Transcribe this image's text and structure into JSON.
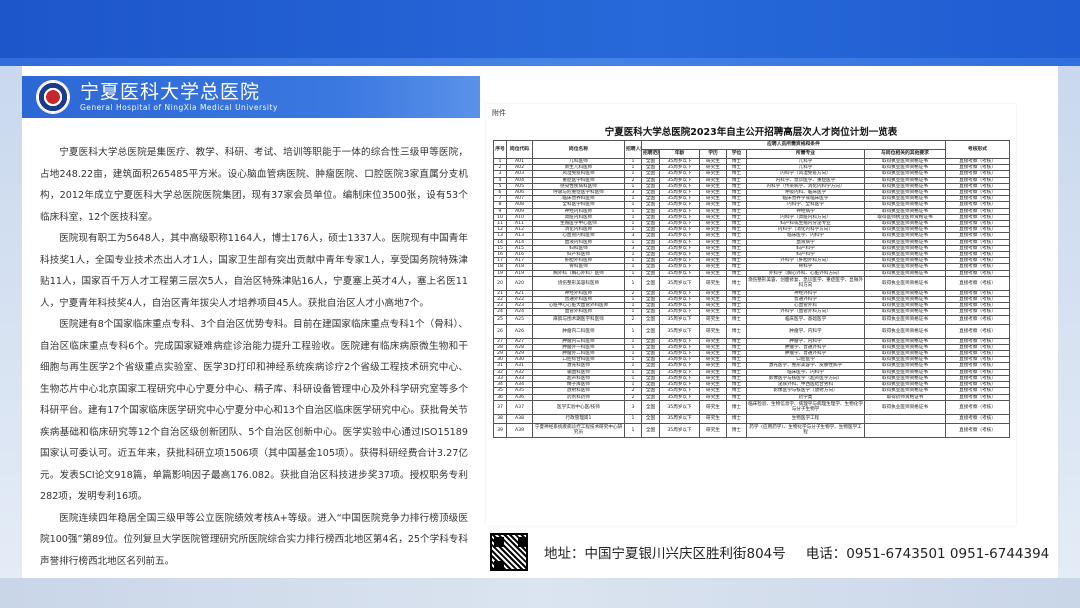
{
  "header": {
    "hospital_name_cn": "宁夏医科大学总医院",
    "hospital_name_en": "General Hospital of NingXia Medical University"
  },
  "intro": {
    "paragraphs": [
      "宁夏医科大学总医院是集医疗、教学、科研、考试、培训等职能于一体的综合性三级甲等医院，占地248.22亩，建筑面积265485平方米。设心脑血管病医院、肿瘤医院、口腔医院3家直属分支机构，2012年成立宁夏医科大学总医院医院集团，现有37家会员单位。编制床位3500张，设有53个临床科室，12个医技科室。",
      "医院现有职工为5648人，其中高级职称1164人，博士176人，硕士1337人。医院现有中国青年科技奖1人，全国专业技术杰出人才1人，国家卫生部有突出贡献中青年专家1人，享受国务院特殊津贴11人，国家百千万人才工程第三层次5人，自治区特殊津贴16人，宁夏塞上英才4人，塞上名医11人，宁夏青年科技奖4人，自治区青年拔尖人才培养项目45人。获批自治区人才小高地7个。",
      "医院建有8个国家临床重点专科、3个自治区优势专科。目前在建国家临床重点专科1个（骨科）、自治区临床重点专科6个。完成国家疑难病症诊治能力提升工程验收。医院建有临床病原微生物和干细胞与再生医学2个省级重点实验室、医学3D打印和神经系统疾病诊疗2个省级工程技术研究中心、生物芯片中心北京国家工程研究中心宁夏分中心、精子库、科研设备管理中心及外科学研究室等多个科研平台。建有17个国家临床医学研究中心宁夏分中心和13个自治区临床医学研究中心。获批骨关节疾病基础和临床研究等12个自治区级创新团队、5个自治区创新中心。医学实验中心通过ISO15189国家认可委认可。近五年来，获批科研立项1506项（其中国基金105项）。获得科研经费合计3.27亿元。发表SCI论文918篇，单篇影响因子最高176.082。获批自治区科技进步奖37项。授权职务专利282项，发明专利16项。",
      "医院连续四年稳居全国三级甲等公立医院绩效考核A+等级。进入“中国医院竞争力排行榜顶级医院100强”第89位。位列复旦大学医院管理研究所医院综合实力排行榜西北地区第4名，25个学科专科声誉排行榜西北地区名列前五。"
    ]
  },
  "document": {
    "attachment_label": "附件",
    "title": "宁夏医科大学总医院2023年自主公开招聘高层次人才岗位计划一览表",
    "headers": {
      "seq": "序号",
      "code": "岗位代码",
      "post": "岗位名称",
      "count": "招聘人数",
      "group": "应聘人员所需资格和条件",
      "scope": "招聘范围",
      "age": "年龄",
      "edu": "学历",
      "degree": "学位",
      "major": "所需专业",
      "other": "与岗位相关的其他要求",
      "exam": "考核形式"
    },
    "rows": [
      [
        "1",
        "A01",
        "儿科医师",
        "1",
        "全国",
        "35周岁以下",
        "研究生",
        "博士",
        "儿科学",
        "取得执业医师资格证书",
        "直接考察（考核）"
      ],
      [
        "2",
        "A02",
        "新生儿科医师",
        "1",
        "全国",
        "35周岁以下",
        "研究生",
        "博士",
        "儿科学",
        "取得执业医师资格证书",
        "直接考察（考核）"
      ],
      [
        "3",
        "A03",
        "风湿免疫科医师",
        "1",
        "全国",
        "35周岁以下",
        "研究生",
        "博士",
        "内科学（风湿免疫方向）",
        "取得执业医师资格证书",
        "直接考察（考核）"
      ],
      [
        "4",
        "A04",
        "重症医学科医师",
        "2",
        "全国",
        "35周岁以下",
        "研究生",
        "博士",
        "内科学、急诊医学、重症医学",
        "取得执业医师资格证书",
        "直接考察（考核）"
      ],
      [
        "5",
        "A05",
        "感染性疾病科医师",
        "1",
        "全国",
        "35周岁以下",
        "研究生",
        "博士",
        "内科学（传染病学、消化内科学方向）",
        "取得执业医师资格证书",
        "直接考察（考核）"
      ],
      [
        "6",
        "A06",
        "呼吸与危重症医学科医师",
        "3",
        "全国",
        "35周岁以下",
        "研究生",
        "博士",
        "呼吸内科、临床医学",
        "取得执业医师资格证书",
        "直接考察（考核）"
      ],
      [
        "7",
        "A07",
        "临床营养科医师",
        "1",
        "全国",
        "35周岁以下",
        "研究生",
        "博士",
        "临床营养学或临床医学",
        "取得执业医师资格证书",
        "直接考察（考核）"
      ],
      [
        "8",
        "A08",
        "全科医学科医师",
        "1",
        "全国",
        "35周岁以下",
        "研究生",
        "博士",
        "内科学、全科医学",
        "取得执业医师资格证书",
        "直接考察（考核）"
      ],
      [
        "9",
        "A09",
        "神经内科医师",
        "1",
        "全国",
        "35周岁以下",
        "研究生",
        "博士",
        "神经病学",
        "取得执业医师资格证书",
        "直接考察（考核）"
      ],
      [
        "10",
        "A10",
        "肾脏内科医师",
        "1",
        "全国",
        "35周岁以下",
        "研究生",
        "博士",
        "内科学（肾脏内科方向）",
        "取得医师执业医师资格证书",
        "直接考察（考核）"
      ],
      [
        "11",
        "A11",
        "生殖医学中心医师",
        "1",
        "全国",
        "35周岁以下",
        "研究生",
        "博士",
        "妇产科或生殖内分泌专业",
        "取得执业医师资格证书",
        "直接考察（考核）"
      ],
      [
        "12",
        "A12",
        "消化内科医师",
        "1",
        "全国",
        "35周岁以下",
        "研究生",
        "博士",
        "内科学（消化内科学方向）",
        "取得执业医师资格证书",
        "直接考察（考核）"
      ],
      [
        "13",
        "A13",
        "心血管内科医师",
        "3",
        "全国",
        "35周岁以下",
        "研究生",
        "博士",
        "临床医学、内科学",
        "取得执业医师资格证书",
        "直接考察（考核）"
      ],
      [
        "14",
        "A14",
        "血液内科医师",
        "1",
        "全国",
        "35周岁以下",
        "研究生",
        "博士",
        "血液病学",
        "取得执业医师资格证书",
        "直接考察（考核）"
      ],
      [
        "15",
        "A15",
        "妇科医师",
        "3",
        "全国",
        "35周岁以下",
        "研究生",
        "博士",
        "妇产科学",
        "取得执业医师资格证书",
        "直接考察（考核）"
      ],
      [
        "16",
        "A16",
        "妇产科医师",
        "1",
        "全国",
        "35周岁以下",
        "研究生",
        "博士",
        "妇产科学",
        "取得执业医师资格证书",
        "直接考察（考核）"
      ],
      [
        "17",
        "A17",
        "肝胆外科医师",
        "1",
        "全国",
        "35周岁以下",
        "研究生",
        "博士",
        "外科学（肝胆外科方向）",
        "取得执业医师资格证书",
        "直接考察（考核）"
      ],
      [
        "18",
        "A18",
        "骨科医师",
        "1",
        "全国",
        "35周岁以下",
        "研究生",
        "博士",
        "骨科学",
        "取得执业医师资格证书",
        "直接考察（考核）"
      ],
      [
        "19",
        "A19",
        "胸外科（胸心外科）医师",
        "1",
        "全国",
        "35周岁以下",
        "研究生",
        "博士",
        "外科学（胸心外科、心脏外科方向）",
        "取得执业医师资格证书",
        "直接考察（考核）"
      ],
      [
        "20",
        "A20",
        "烧伤整形美容科医师",
        "1",
        "全国",
        "35周岁以下",
        "研究生",
        "博士",
        "烧伤整形美容、创面修复、急诊医学、重症医学、显微外科方向",
        "取得执业医师资格证书",
        "直接考察（考核）"
      ],
      [
        "21",
        "A21",
        "神经外科医师",
        "2",
        "全国",
        "35周岁以下",
        "研究生",
        "博士",
        "神经外科学",
        "取得执业医师资格证书",
        "直接考察（考核）"
      ],
      [
        "22",
        "A22",
        "普通外科医师",
        "1",
        "全国",
        "35周岁以下",
        "研究生",
        "博士",
        "普通外科学",
        "取得执业医师资格证书",
        "直接考察（考核）"
      ],
      [
        "23",
        "A23",
        "心脏中心心脏大血管外科医师",
        "1",
        "全国",
        "35周岁以下",
        "研究生",
        "博士",
        "心血管外科",
        "取得执业医师资格证书",
        "直接考察（考核）"
      ],
      [
        "24",
        "A24",
        "血管外科医师",
        "1",
        "全国",
        "35周岁以下",
        "研究生",
        "博士",
        "外科学（血管外科方向）",
        "取得执业医师资格证书",
        "直接考察（考核）"
      ],
      [
        "25",
        "A25",
        "麻醉与围术期医学科医师",
        "2",
        "全国",
        "35周岁以下",
        "研究生",
        "博士",
        "临床医学、基础医学",
        "取得执业医师资格证书",
        "直接考察（考核）"
      ],
      [
        "26",
        "A26",
        "肿瘤内二科医师",
        "1",
        "全国",
        "35周岁以下",
        "研究生",
        "博士",
        "肿瘤学、内科学",
        "取得执业医师资格证书",
        "直接考察（考核）"
      ],
      [
        "27",
        "A27",
        "肿瘤内三科医师",
        "1",
        "全国",
        "35周岁以下",
        "研究生",
        "博士",
        "肿瘤学、内科学",
        "取得执业医师资格证书",
        "直接考察（考核）"
      ],
      [
        "28",
        "A28",
        "肿瘤外一科医师",
        "1",
        "全国",
        "35周岁以下",
        "研究生",
        "博士",
        "肿瘤学、普通外科学",
        "取得执业医师资格证书",
        "直接考察（考核）"
      ],
      [
        "29",
        "A29",
        "肿瘤外二科医师",
        "1",
        "全国",
        "35周岁以下",
        "研究生",
        "博士",
        "肿瘤学、普通外科学",
        "取得执业医师资格证书",
        "直接考察（考核）"
      ],
      [
        "30",
        "A30",
        "口腔综合科医师",
        "1",
        "全国",
        "35周岁以下",
        "研究生",
        "博士",
        "口腔医学",
        "取得执业医师资格证书",
        "直接考察（考核）"
      ],
      [
        "31",
        "A31",
        "激光科医师",
        "1",
        "全国",
        "35周岁以下",
        "研究生",
        "博士",
        "激光医学、整形美容学、皮肤性病学",
        "取得执业医师资格证书",
        "直接考察（考核）"
      ],
      [
        "32",
        "A32",
        "输血科医师",
        "1",
        "全国",
        "35周岁以下",
        "研究生",
        "博士",
        "临床医学、内科学",
        "取得执业医师资格证书",
        "直接考察（考核）"
      ],
      [
        "33",
        "A33",
        "超声科医师",
        "1",
        "全国",
        "35周岁以下",
        "研究生",
        "博士",
        "影像医学与核医学（超声医学方向）",
        "取得执业医师资格证书",
        "直接考察（考核）"
      ],
      [
        "34",
        "A34",
        "精子库医师",
        "1",
        "全国",
        "35周岁以下",
        "研究生",
        "博士",
        "泌尿外科、中西医结合男科",
        "取得执业医师资格证书",
        "直接考察（考核）"
      ],
      [
        "35",
        "A35",
        "放射科医师",
        "2",
        "全国",
        "35周岁以下",
        "研究生",
        "博士",
        "影像医学与核医学（放射方向）",
        "取得执业医师资格证书",
        "直接考察（考核）"
      ],
      [
        "36",
        "A36",
        "药剂科药师",
        "2",
        "全国",
        "35周岁以下",
        "研究生",
        "博士",
        "药学类",
        "取得药师资格证书",
        "直接考察（考核）"
      ],
      [
        "37",
        "A37",
        "医学实验中心医/技师",
        "3",
        "全国",
        "35周岁以下",
        "研究生",
        "博士",
        "临床检验、生物信息学、病理学与病理生理学、生物化学与分子生物学",
        "取得执业医师资格证书",
        "直接考察（考核）"
      ],
      [
        "38",
        "A38",
        "行政管理岗1",
        "1",
        "全国",
        "35周岁以下",
        "研究生",
        "博士",
        "生物医学工程",
        "",
        "直接考察（考核）"
      ],
      [
        "39",
        "A39",
        "宁夏神经系统疾病诊疗工程技术研究中心研究员",
        "1",
        "全国",
        "35周岁以下",
        "研究生",
        "博士",
        "药学（应用药学）、生物化学与分子生物学、生物医学工程",
        "",
        "直接考察（考核）"
      ]
    ]
  },
  "footer": {
    "address": "地址：中国宁夏银川兴庆区胜利街804号",
    "phone": "电话：0951-6743501   0951-6744394"
  }
}
